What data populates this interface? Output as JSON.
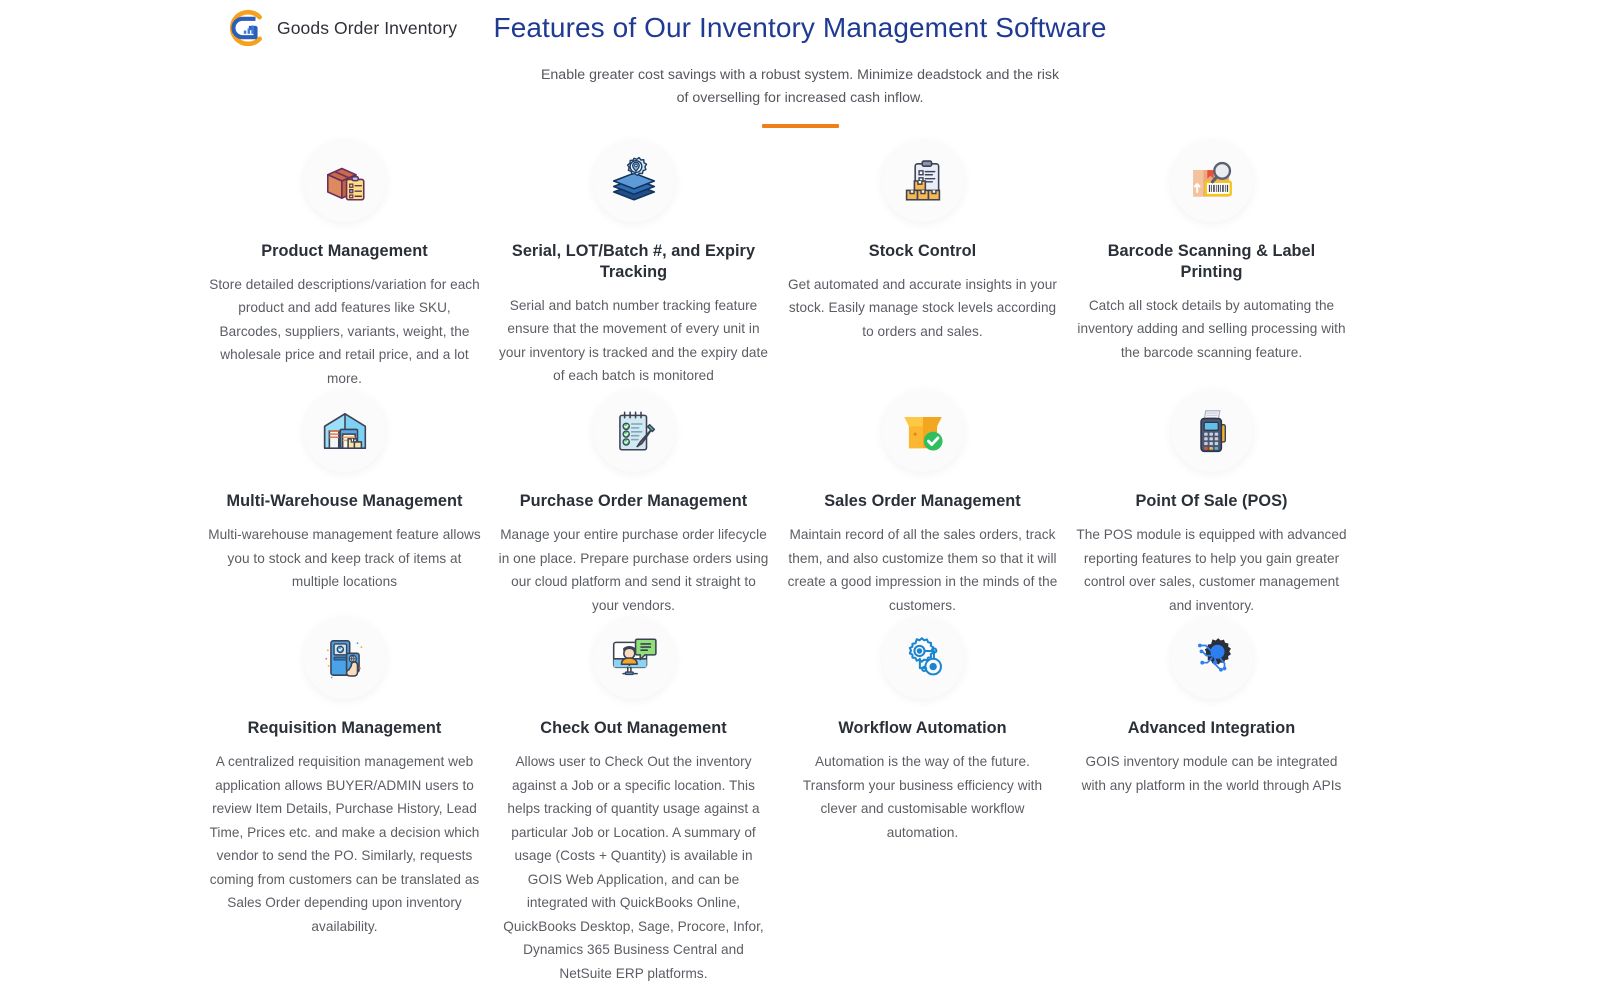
{
  "brand": {
    "name": "Goods Order Inventory",
    "logo_icon": "gois-logo-icon",
    "colors": {
      "orange": "#f5a11e",
      "blue": "#2b5fb8"
    }
  },
  "header": {
    "title": "Features of Our Inventory Management Software",
    "subtitle": "Enable greater cost savings with a robust system. Minimize deadstock and the risk of overselling for increased cash inflow.",
    "divider_color": "#ef8018",
    "title_color": "#1f3a93"
  },
  "features": [
    {
      "icon": "package-box-checklist-icon",
      "title": "Product Management",
      "desc": "Store detailed descriptions/variation for each product and add features like SKU, Barcodes, suppliers, variants, weight, the wholesale price and retail price, and a lot more."
    },
    {
      "icon": "gear-layers-location-icon",
      "title": "Serial, LOT/Batch #, and Expiry Tracking",
      "desc": "Serial and batch number tracking feature ensure that the movement of every unit in your inventory is tracked and the expiry date of each batch is monitored"
    },
    {
      "icon": "clipboard-boxes-icon",
      "title": "Stock Control",
      "desc": "Get automated and accurate insights in your stock. Easily manage stock levels according to orders and sales."
    },
    {
      "icon": "barcode-magnifier-box-icon",
      "title": "Barcode Scanning & Label Printing",
      "desc": "Catch all stock details by automating the inventory adding and selling processing with the barcode scanning feature."
    },
    {
      "icon": "warehouse-icon",
      "title": "Multi-Warehouse Management",
      "desc": "Multi-warehouse management feature allows you to stock and keep track of items at multiple locations"
    },
    {
      "icon": "notepad-checklist-pencil-icon",
      "title": "Purchase Order Management",
      "desc": "Manage your entire purchase order lifecycle in one place. Prepare purchase orders using our cloud platform and send it straight to your vendors."
    },
    {
      "icon": "open-box-check-icon",
      "title": "Sales Order Management",
      "desc": "Maintain record of all the sales orders, track them, and also customize them so that it will create a good impression in the minds of the customers."
    },
    {
      "icon": "pos-card-terminal-icon",
      "title": "Point Of Sale (POS)",
      "desc": "The POS module is equipped with advanced reporting features to help you gain greater control over sales, customer management and inventory."
    },
    {
      "icon": "kiosk-hand-touch-icon",
      "title": "Requisition Management",
      "desc": "A centralized requisition management web application allows BUYER/ADMIN users to review Item Details, Purchase History, Lead Time, Prices etc. and make a decision which vendor to send the PO. Similarly, requests coming from customers can be translated as Sales Order depending upon inventory availability."
    },
    {
      "icon": "monitor-user-chat-icon",
      "title": "Check Out Management",
      "desc": "Allows user to Check Out the inventory against a Job or a specific location. This helps tracking of quantity usage against a particular Job or Location. A summary of usage (Costs + Quantity) is available in GOIS Web Application, and can be integrated with QuickBooks Online, QuickBooks Desktop, Sage, Procore, Infor, Dynamics 365 Business Central and NetSuite ERP platforms."
    },
    {
      "icon": "gear-network-nodes-icon",
      "title": "Workflow Automation",
      "desc": "Automation is the way of the future. Transform your business efficiency with clever and customisable workflow automation."
    },
    {
      "icon": "gear-circuit-integration-icon",
      "title": "Advanced Integration",
      "desc": "GOIS inventory module can be integrated with any platform in the world through APIs"
    }
  ]
}
